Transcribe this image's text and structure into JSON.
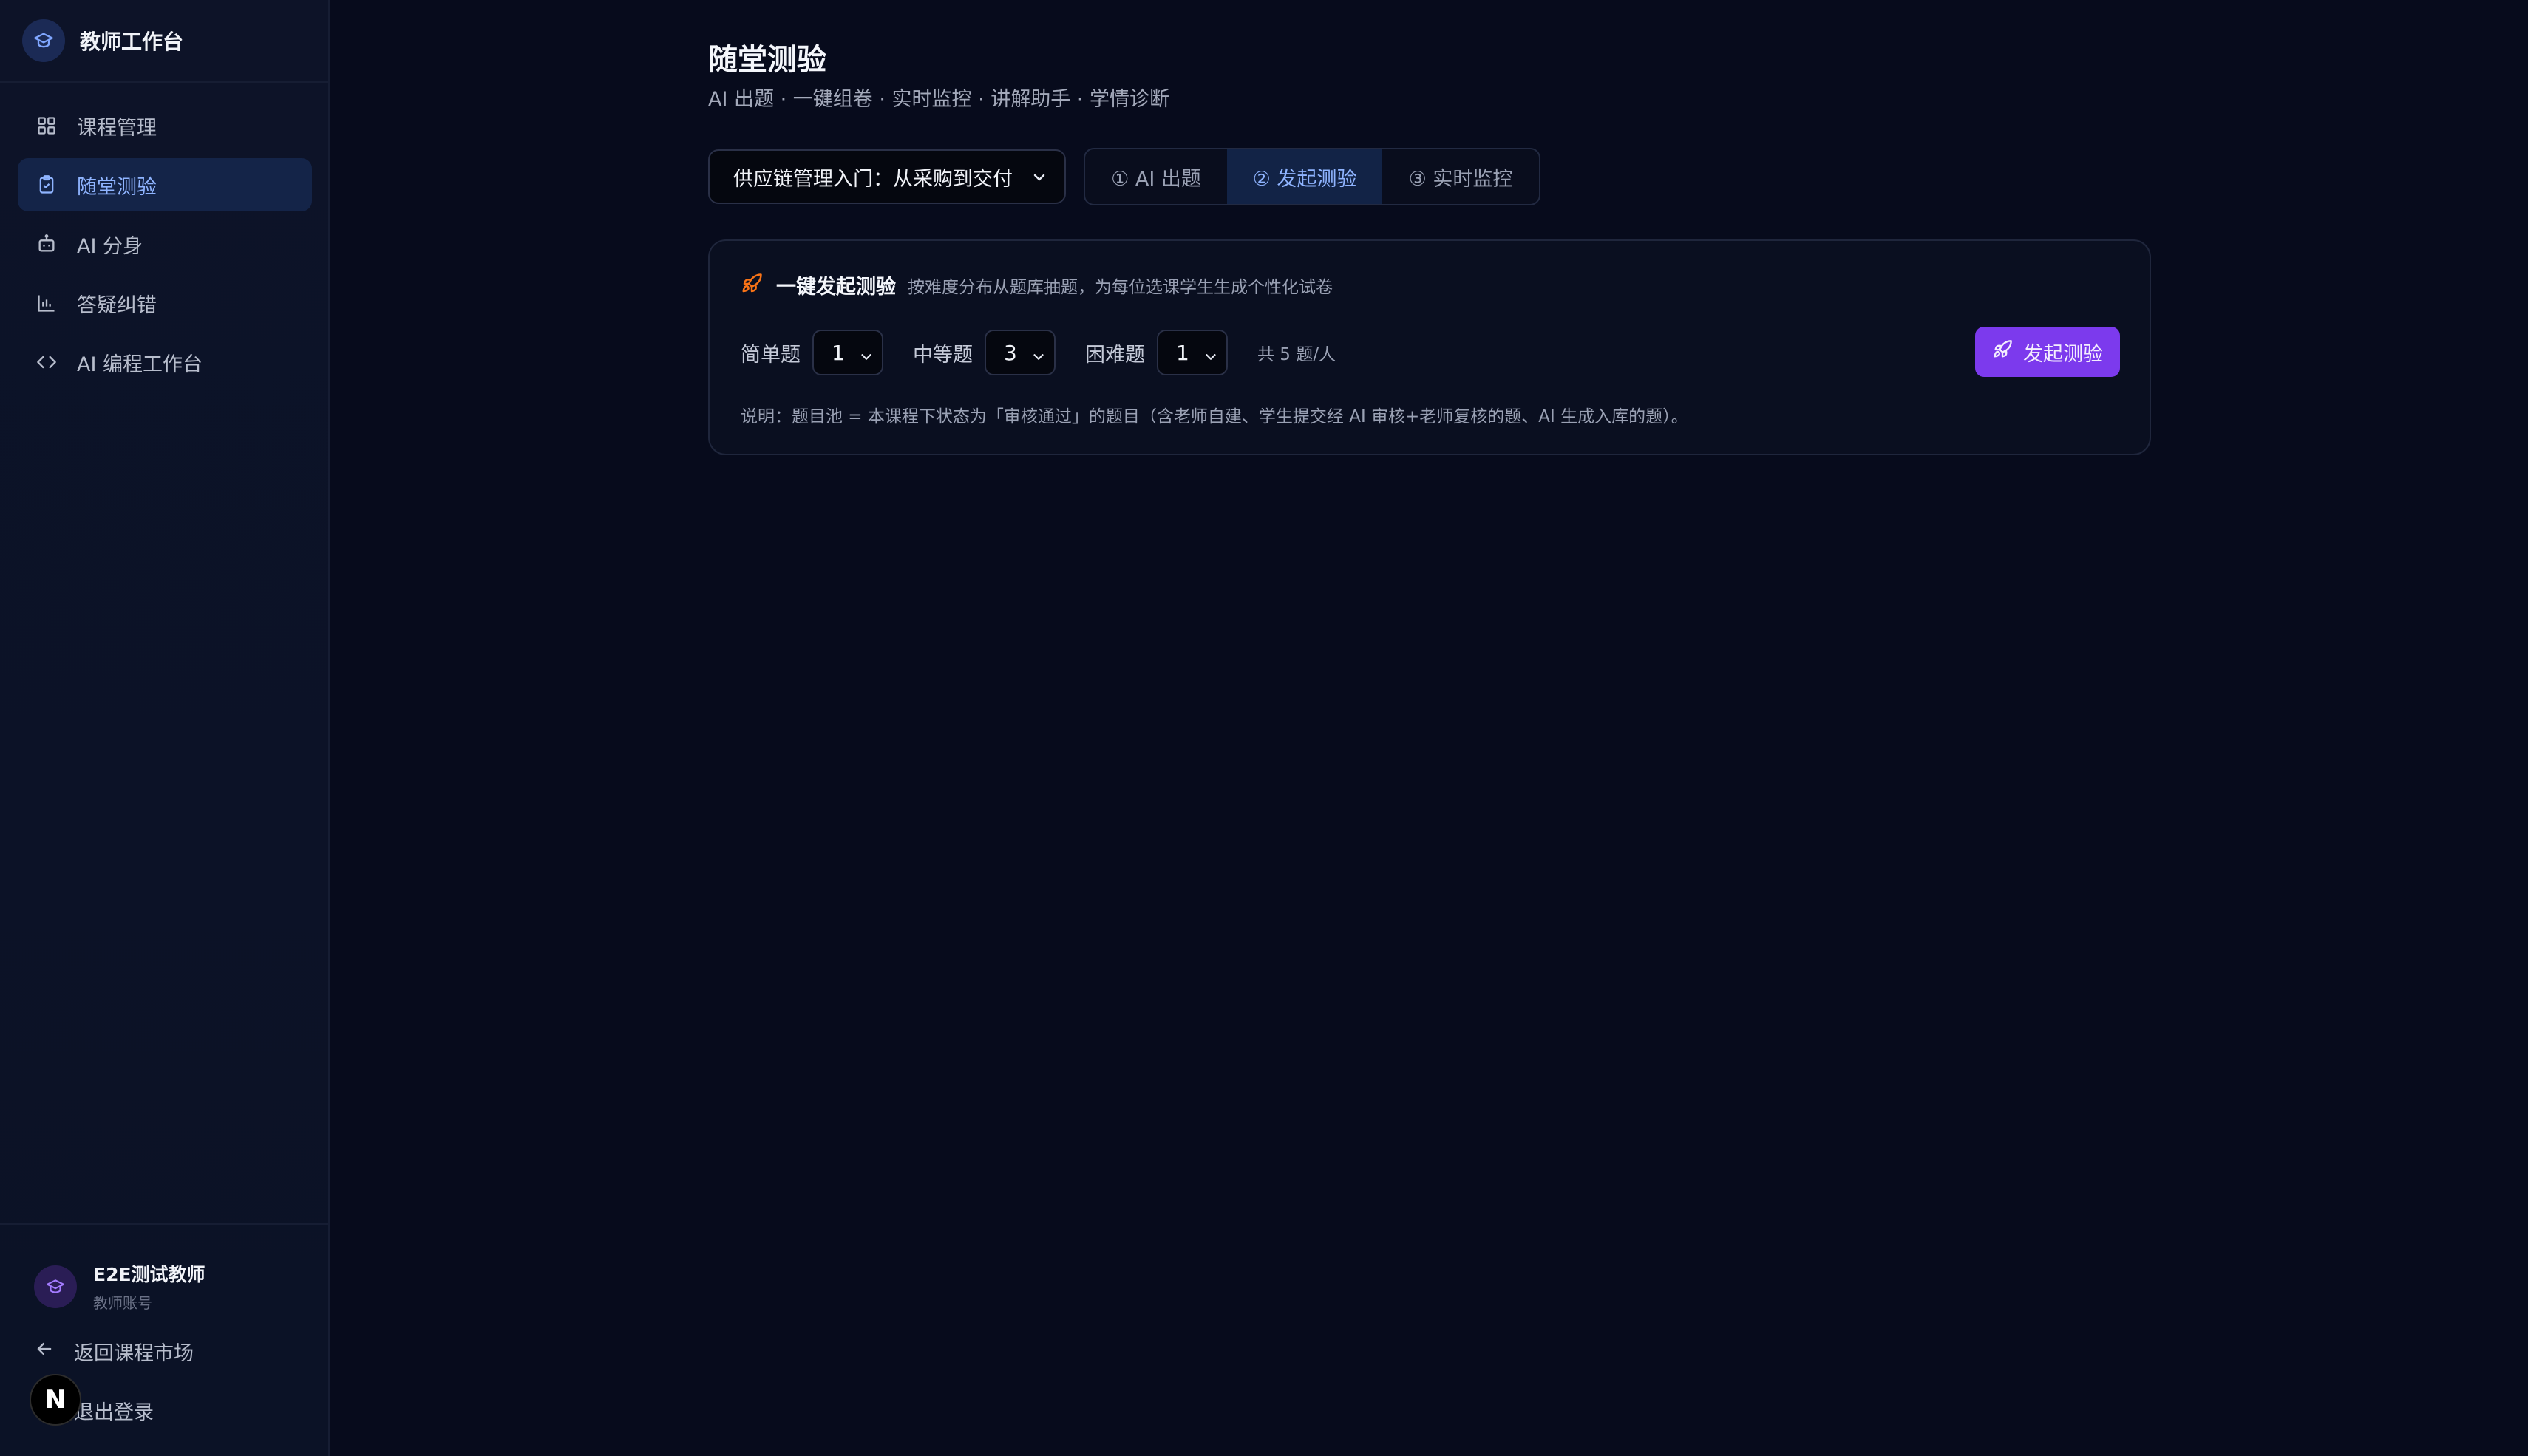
{
  "brand": {
    "title": "教师工作台"
  },
  "sidebar": {
    "items": [
      {
        "label": "课程管理",
        "icon": "grid-icon",
        "active": false
      },
      {
        "label": "随堂测验",
        "icon": "clipboard-check-icon",
        "active": true
      },
      {
        "label": "AI 分身",
        "icon": "robot-icon",
        "active": false
      },
      {
        "label": "答疑纠错",
        "icon": "bar-chart-icon",
        "active": false
      },
      {
        "label": "AI 编程工作台",
        "icon": "code-icon",
        "active": false
      }
    ]
  },
  "user": {
    "name": "E2E测试教师",
    "role": "教师账号"
  },
  "bottom_links": {
    "back": "返回课程市场",
    "logout": "退出登录"
  },
  "badge": {
    "letter": "N"
  },
  "page": {
    "title": "随堂测验",
    "subtitle": "AI 出题 · 一键组卷 · 实时监控 · 讲解助手 · 学情诊断"
  },
  "course_select": {
    "value": "供应链管理入门：从采购到交付"
  },
  "steps": [
    {
      "label": "① AI 出题",
      "active": false
    },
    {
      "label": "② 发起测验",
      "active": true
    },
    {
      "label": "③ 实时监控",
      "active": false
    }
  ],
  "card": {
    "title": "一键发起测验",
    "desc": "按难度分布从题库抽题，为每位选课学生生成个性化试卷",
    "easy_label": "简单题",
    "easy_value": "1",
    "medium_label": "中等题",
    "medium_value": "3",
    "hard_label": "困难题",
    "hard_value": "1",
    "total": "共 5 题/人",
    "launch_label": "发起测验",
    "note": "说明：题目池 = 本课程下状态为「审核通过」的题目（含老师自建、学生提交经 AI 审核+老师复核的题、AI 生成入库的题）。"
  },
  "colors": {
    "background": "#070b1c",
    "sidebar": "#0d1328",
    "accent_blue": "#8fb4ff",
    "active_bg": "#142448",
    "launch_button": "#7c3aed",
    "rocket_orange": "#f97316"
  }
}
